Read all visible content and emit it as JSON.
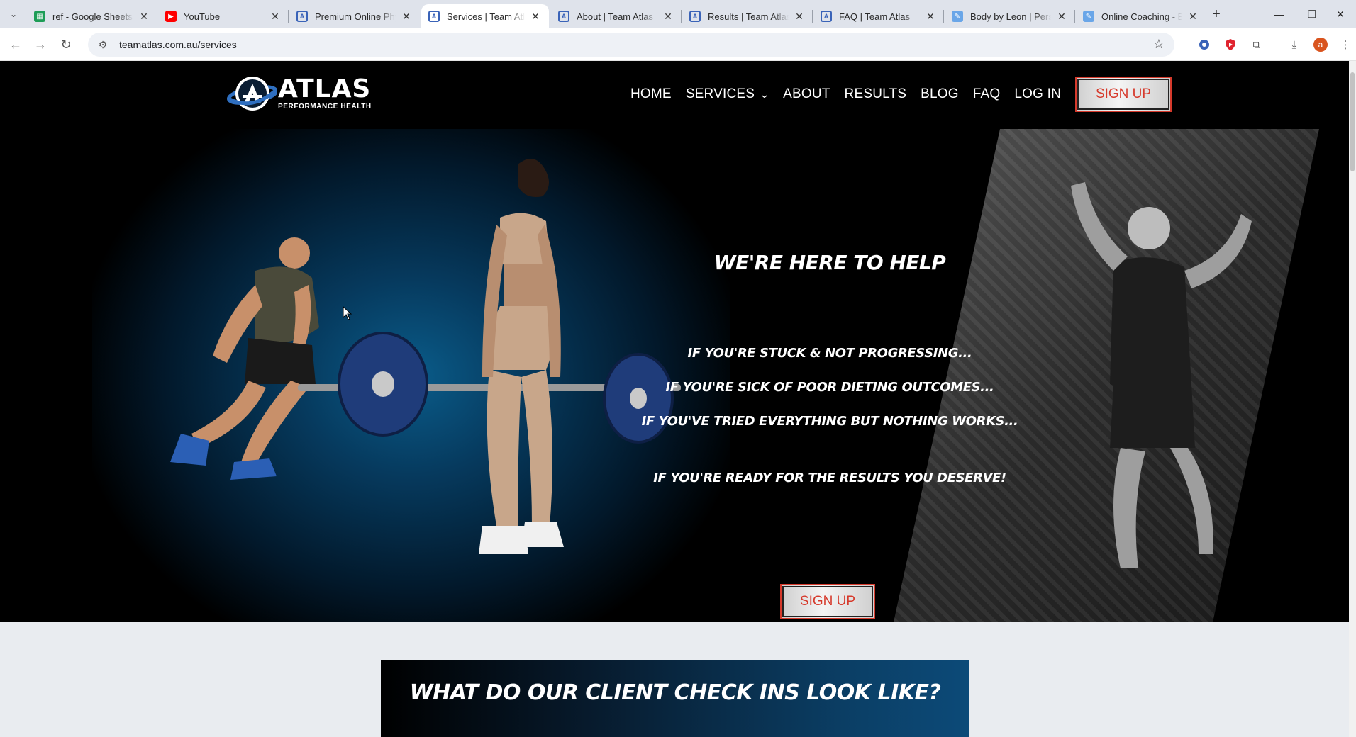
{
  "browser": {
    "tabs": [
      {
        "title": "ref - Google Sheets",
        "favicon": "sheets-icon"
      },
      {
        "title": "YouTube",
        "favicon": "youtube-icon"
      },
      {
        "title": "Premium Online Phys",
        "favicon": "atlas-icon"
      },
      {
        "title": "Services | Team Atlas",
        "favicon": "atlas-icon",
        "active": true
      },
      {
        "title": "About | Team Atlas",
        "favicon": "atlas-icon"
      },
      {
        "title": "Results | Team Atlas",
        "favicon": "atlas-icon"
      },
      {
        "title": "FAQ | Team Atlas",
        "favicon": "atlas-icon"
      },
      {
        "title": "Body by Leon | Perso",
        "favicon": "doc-icon"
      },
      {
        "title": "Online Coaching - Bo",
        "favicon": "doc-icon"
      }
    ],
    "url": "teamatlas.com.au/services",
    "profile_initial": "a"
  },
  "site": {
    "logo": {
      "name": "ATLAS",
      "tagline": "PERFORMANCE HEALTH"
    },
    "nav": [
      "HOME",
      "SERVICES",
      "ABOUT",
      "RESULTS",
      "BLOG",
      "FAQ",
      "LOG IN"
    ],
    "signup_label": "SIGN UP"
  },
  "hero": {
    "title": "WE'RE HERE TO HELP",
    "lines": [
      "IF YOU'RE STUCK & NOT PROGRESSING...",
      "IF YOU'RE SICK OF POOR DIETING OUTCOMES...",
      "IF YOU'VE TRIED EVERYTHING BUT NOTHING WORKS...",
      "IF YOU'RE READY FOR THE RESULTS YOU DESERVE!"
    ],
    "cta_label": "SIGN UP"
  },
  "checkin": {
    "title": "WHAT DO OUR CLIENT CHECK INS LOOK LIKE?"
  },
  "colors": {
    "accent_red": "#d63a2c",
    "hero_blue": "#0a5c8a"
  }
}
